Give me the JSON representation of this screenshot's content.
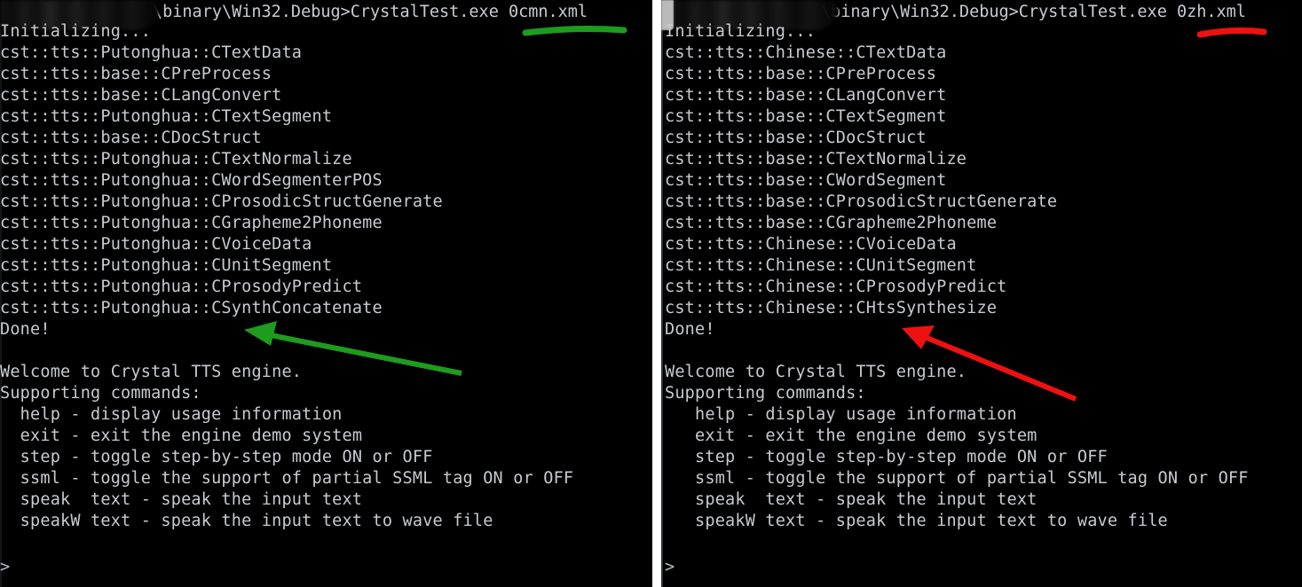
{
  "window": {
    "title": "CrystalTest.exe console comparison",
    "background_color": "#000000",
    "text_color": "#c8cbd0",
    "divider_color": "#ffffff"
  },
  "panels": [
    {
      "id": "left",
      "name": "putonghua-console",
      "header": {
        "redacted_path": "",
        "command_line": "\\binary\\Win32.Debug>CrystalTest.exe 0cmn.xml"
      },
      "lines": [
        "Initializing...",
        "cst::tts::Putonghua::CTextData",
        "cst::tts::base::CPreProcess",
        "cst::tts::base::CLangConvert",
        "cst::tts::Putonghua::CTextSegment",
        "cst::tts::base::CDocStruct",
        "cst::tts::Putonghua::CTextNormalize",
        "cst::tts::Putonghua::CWordSegmenterPOS",
        "cst::tts::Putonghua::CProsodicStructGenerate",
        "cst::tts::Putonghua::CGrapheme2Phoneme",
        "cst::tts::Putonghua::CVoiceData",
        "cst::tts::Putonghua::CUnitSegment",
        "cst::tts::Putonghua::CProsodyPredict",
        "cst::tts::Putonghua::CSynthConcatenate",
        "Done!",
        "",
        "Welcome to Crystal TTS engine.",
        "Supporting commands:",
        "  help - display usage information",
        "  exit - exit the engine demo system",
        "  step - toggle step-by-step mode ON or OFF",
        "  ssml - toggle the support of partial SSML tag ON or OFF",
        "  speak  text - speak the input text",
        "  speakW text - speak the input text to wave file"
      ],
      "prompt": ">",
      "annotation_color": "#1a9c1a"
    },
    {
      "id": "right",
      "name": "chinese-console",
      "header": {
        "redacted_path": "",
        "command_line": "\\binary\\Win32.Debug>CrystalTest.exe 0zh.xml"
      },
      "lines": [
        "Initializing...",
        "cst::tts::Chinese::CTextData",
        "cst::tts::base::CPreProcess",
        "cst::tts::base::CLangConvert",
        "cst::tts::base::CTextSegment",
        "cst::tts::base::CDocStruct",
        "cst::tts::base::CTextNormalize",
        "cst::tts::base::CWordSegment",
        "cst::tts::base::CProsodicStructGenerate",
        "cst::tts::base::CGrapheme2Phoneme",
        "cst::tts::Chinese::CVoiceData",
        "cst::tts::Chinese::CUnitSegment",
        "cst::tts::Chinese::CProsodyPredict",
        "cst::tts::Chinese::CHtsSynthesize",
        "Done!",
        "",
        "Welcome to Crystal TTS engine.",
        "Supporting commands:",
        "   help - display usage information",
        "   exit - exit the engine demo system",
        "   step - toggle step-by-step mode ON or OFF",
        "   ssml - toggle the support of partial SSML tag ON or OFF",
        "   speak  text - speak the input text",
        "   speakW text - speak the input text to wave file"
      ],
      "prompt": ">",
      "annotation_color": "#ee1111"
    }
  ],
  "annotations": [
    {
      "name": "green-underline",
      "shape": "underline",
      "color": "#1d9c1d",
      "target": "0cmn.xml"
    },
    {
      "name": "green-arrow",
      "shape": "arrow",
      "color": "#1d9c1d",
      "target": "cst::tts::Putonghua::CSynthConcatenate"
    },
    {
      "name": "red-underline",
      "shape": "underline",
      "color": "#ee1111",
      "target": "0zh.xml"
    },
    {
      "name": "red-arrow",
      "shape": "arrow",
      "color": "#ee1111",
      "target": "cst::tts::Chinese::CHtsSynthesize"
    }
  ]
}
